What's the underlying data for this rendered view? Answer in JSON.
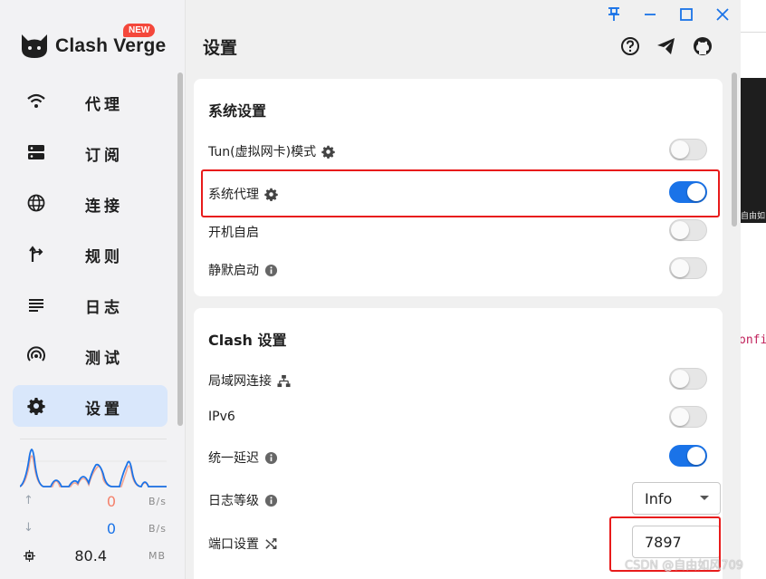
{
  "window": {
    "pin": "pin",
    "minimize": "minimize",
    "maximize": "maximize",
    "close": "close"
  },
  "app": {
    "name": "Clash Verge",
    "badge": "NEW"
  },
  "sidebar": {
    "items": [
      {
        "label": "代理",
        "icon": "wifi-icon"
      },
      {
        "label": "订阅",
        "icon": "dns-icon"
      },
      {
        "label": "连接",
        "icon": "globe-icon"
      },
      {
        "label": "规则",
        "icon": "fork-icon"
      },
      {
        "label": "日志",
        "icon": "list-icon"
      },
      {
        "label": "测试",
        "icon": "radar-icon"
      },
      {
        "label": "设置",
        "icon": "gear-icon",
        "active": true
      }
    ],
    "traffic": {
      "upload": {
        "value": "0",
        "unit": "B/s",
        "color": "#f4806a"
      },
      "download": {
        "value": "0",
        "unit": "B/s",
        "color": "#1a73e8"
      },
      "memory": {
        "value": "80.4",
        "unit": "MB"
      }
    }
  },
  "header": {
    "title": "设置",
    "icons": [
      "help-icon",
      "telegram-icon",
      "github-icon"
    ]
  },
  "system_settings": {
    "title": "系统设置",
    "rows": [
      {
        "label": "Tun(虚拟网卡)模式",
        "icon": "gear-icon",
        "on": false
      },
      {
        "label": "系统代理",
        "icon": "gear-icon",
        "on": true
      },
      {
        "label": "开机自启",
        "on": false
      },
      {
        "label": "静默启动",
        "icon": "info-icon",
        "on": false
      }
    ]
  },
  "clash_settings": {
    "title": "Clash 设置",
    "rows": [
      {
        "label": "局域网连接",
        "icon": "network-icon",
        "on": false
      },
      {
        "label": "IPv6",
        "on": false
      },
      {
        "label": "统一延迟",
        "icon": "info-icon",
        "on": true
      },
      {
        "label": "日志等级",
        "icon": "info-icon",
        "select": "Info"
      },
      {
        "label": "端口设置",
        "icon": "shuffle-icon",
        "port": "7897"
      }
    ]
  },
  "background": {
    "snippet_text": "自由如",
    "code_text": "onfi"
  },
  "watermark": "CSDN @自由如风709",
  "colors": {
    "accent": "#1a73e8",
    "highlight": "#e81b1b",
    "badge": "#f4473b"
  }
}
